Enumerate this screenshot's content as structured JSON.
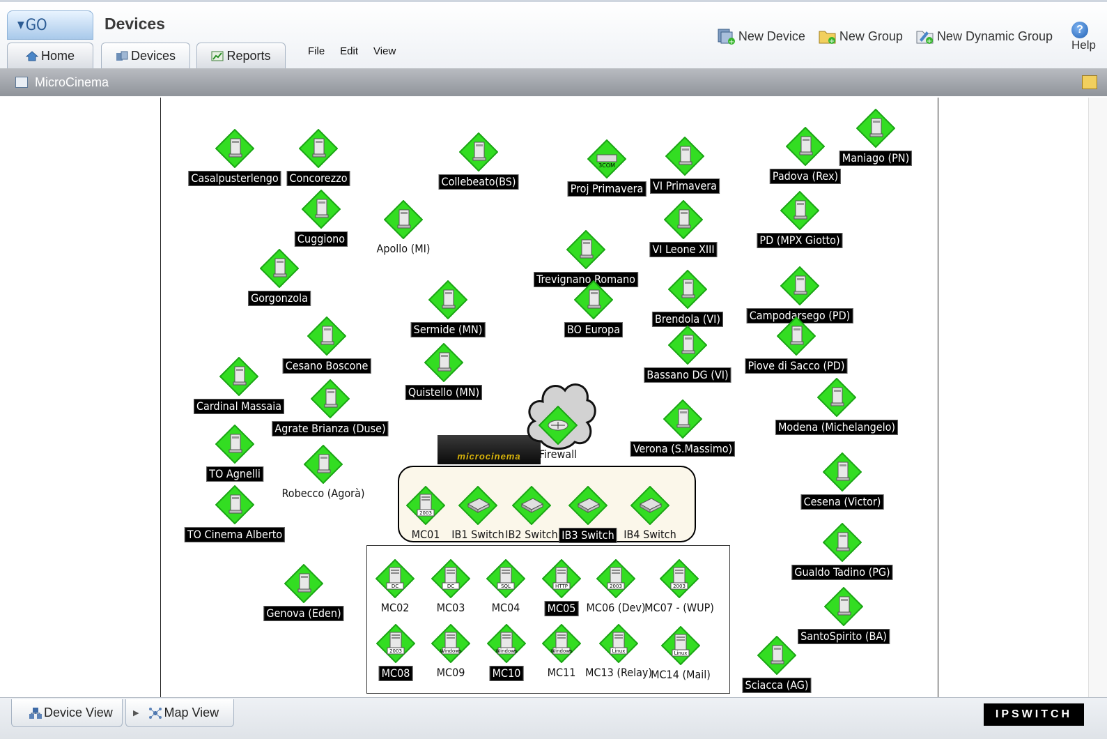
{
  "header": {
    "go_label": "GO",
    "page_title": "Devices",
    "tabs": [
      {
        "label": "Home"
      },
      {
        "label": "Devices"
      },
      {
        "label": "Reports"
      }
    ],
    "menu": [
      "File",
      "Edit",
      "View"
    ],
    "actions": [
      "New Device",
      "New Group",
      "New Dynamic Group"
    ],
    "help_label": "Help",
    "help_glyph": "?"
  },
  "group_bar": {
    "title": "MicroCinema"
  },
  "map": {
    "logo_text": "microcinema",
    "devices": [
      {
        "label": "Casalpusterlengo",
        "style": "black",
        "icon": "computer"
      },
      {
        "label": "Concorezzo",
        "style": "black",
        "icon": "computer"
      },
      {
        "label": "Collebeato(BS)",
        "style": "black",
        "icon": "computer"
      },
      {
        "label": "Proj Primavera",
        "style": "black",
        "icon": "3com"
      },
      {
        "label": "VI Primavera",
        "style": "black",
        "icon": "computer"
      },
      {
        "label": "Padova (Rex)",
        "style": "black",
        "icon": "computer"
      },
      {
        "label": "Maniago (PN)",
        "style": "black",
        "icon": "computer"
      },
      {
        "label": "Cuggiono",
        "style": "black",
        "icon": "computer"
      },
      {
        "label": "Apollo (MI)",
        "style": "plain",
        "icon": "computer"
      },
      {
        "label": "VI Leone XIII",
        "style": "black",
        "icon": "computer"
      },
      {
        "label": "PD (MPX Giotto)",
        "style": "black",
        "icon": "computer"
      },
      {
        "label": "Gorgonzola",
        "style": "black",
        "icon": "computer"
      },
      {
        "label": "Trevignano Romano",
        "style": "black",
        "icon": "computer"
      },
      {
        "label": "Campodarsego (PD)",
        "style": "black",
        "icon": "computer"
      },
      {
        "label": "Sermide (MN)",
        "style": "black",
        "icon": "computer"
      },
      {
        "label": "Brendola (VI)",
        "style": "black",
        "icon": "computer"
      },
      {
        "label": "BO Europa",
        "style": "black",
        "icon": "computer"
      },
      {
        "label": "Cesano Boscone",
        "style": "black",
        "icon": "computer"
      },
      {
        "label": "Bassano DG (VI)",
        "style": "black",
        "icon": "computer"
      },
      {
        "label": "Piove di Sacco (PD)",
        "style": "black",
        "icon": "computer"
      },
      {
        "label": "Quistello (MN)",
        "style": "black",
        "icon": "computer"
      },
      {
        "label": "Cardinal Massaia",
        "style": "black",
        "icon": "computer"
      },
      {
        "label": "Agrate Brianza (Duse)",
        "style": "black",
        "icon": "computer"
      },
      {
        "label": "Modena (Michelangelo)",
        "style": "black",
        "icon": "computer"
      },
      {
        "label": "Firewall",
        "style": "plain",
        "icon": "firewall"
      },
      {
        "label": "Verona (S.Massimo)",
        "style": "black",
        "icon": "computer"
      },
      {
        "label": "TO Agnelli",
        "style": "black",
        "icon": "computer"
      },
      {
        "label": "Robecco (Agorà)",
        "style": "plain",
        "icon": "computer"
      },
      {
        "label": "Cesena (Victor)",
        "style": "black",
        "icon": "computer"
      },
      {
        "label": "TO Cinema Alberto",
        "style": "black",
        "icon": "computer"
      },
      {
        "label": "Gualdo Tadino (PG)",
        "style": "black",
        "icon": "computer"
      },
      {
        "label": "Genova (Eden)",
        "style": "black",
        "icon": "computer"
      },
      {
        "label": "SantoSpirito (BA)",
        "style": "black",
        "icon": "computer"
      },
      {
        "label": "Sciacca (AG)",
        "style": "black",
        "icon": "computer"
      },
      {
        "label": "MC01",
        "style": "plain",
        "icon": "server",
        "sub": "2003"
      },
      {
        "label": "IB1 Switch",
        "style": "plain",
        "icon": "switch"
      },
      {
        "label": "IB2 Switch",
        "style": "plain",
        "icon": "switch"
      },
      {
        "label": "IB3 Switch",
        "style": "black",
        "icon": "switch"
      },
      {
        "label": "IB4 Switch",
        "style": "plain",
        "icon": "switch"
      },
      {
        "label": "MC02",
        "style": "plain",
        "icon": "server",
        "sub": "DC"
      },
      {
        "label": "MC03",
        "style": "plain",
        "icon": "server",
        "sub": "DC"
      },
      {
        "label": "MC04",
        "style": "plain",
        "icon": "server",
        "sub": "SQL"
      },
      {
        "label": "MC05",
        "style": "black",
        "icon": "server",
        "sub": "HTTP"
      },
      {
        "label": "MC06 (Dev)",
        "style": "plain",
        "icon": "server",
        "sub": "2003"
      },
      {
        "label": "MC07 - (WUP)",
        "style": "plain",
        "icon": "server",
        "sub": "2003"
      },
      {
        "label": "MC08",
        "style": "black",
        "icon": "server",
        "sub": "2003"
      },
      {
        "label": "MC09",
        "style": "plain",
        "icon": "server",
        "sub": "Windows"
      },
      {
        "label": "MC10",
        "style": "black",
        "icon": "server",
        "sub": "Windows"
      },
      {
        "label": "MC11",
        "style": "plain",
        "icon": "server",
        "sub": "Windows"
      },
      {
        "label": "MC13 (Relay)",
        "style": "plain",
        "icon": "server",
        "sub": "Linux"
      },
      {
        "label": "MC14 (Mail)",
        "style": "plain",
        "icon": "server",
        "sub": "Linux"
      }
    ]
  },
  "bottom": {
    "tabs": [
      "Device View",
      "Map View"
    ],
    "brand": "IPSWITCH"
  },
  "colors": {
    "node_green": "#33dd22",
    "node_green_dark": "#1aa514",
    "label_bg": "#000000",
    "group_bar": "#9a9ea4",
    "accent_blue": "#2c5c94"
  }
}
